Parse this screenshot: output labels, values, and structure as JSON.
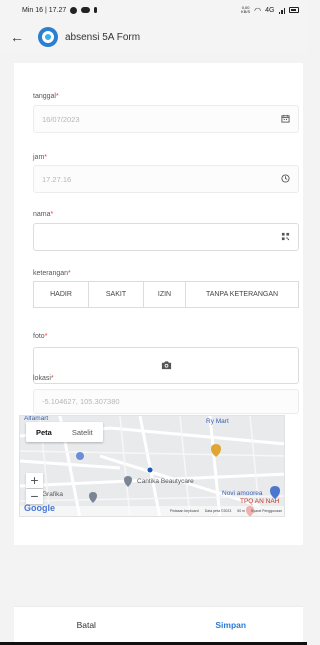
{
  "status_bar": {
    "time": "Min 16 | 17.27",
    "speed": "0,00",
    "speed_unit": "KB/S",
    "network": "4G"
  },
  "header": {
    "title": "absensi 5A Form"
  },
  "form": {
    "tanggal": {
      "label": "tanggal",
      "value": "16/07/2023"
    },
    "jam": {
      "label": "jam",
      "value": "17.27.16"
    },
    "nama": {
      "label": "nama",
      "value": ""
    },
    "keterangan": {
      "label": "keterangan",
      "options": [
        "HADIR",
        "SAKIT",
        "IZIN",
        "TANPA KETERANGAN"
      ]
    },
    "foto": {
      "label": "foto"
    },
    "lokasi": {
      "label": "lokasi",
      "value": "-5.104627, 105.307380",
      "map": {
        "type_options": [
          "Peta",
          "Satelit"
        ],
        "active_type": "Peta",
        "places": [
          "Alfamart",
          "Ry Mart",
          "Cantika Beautycare",
          "Grafika",
          "Novi amoorea",
          "TPQ AN NAH"
        ],
        "footer": [
          "Pintasan keyboard",
          "Data peta ©2023",
          "50 m",
          "Syarat Penggunaan"
        ],
        "google": "Google"
      }
    }
  },
  "required_mark": "*",
  "actions": {
    "cancel": "Batal",
    "save": "Simpan"
  },
  "colors": {
    "accent": "#2a7bd6",
    "required": "#e03c3c"
  }
}
